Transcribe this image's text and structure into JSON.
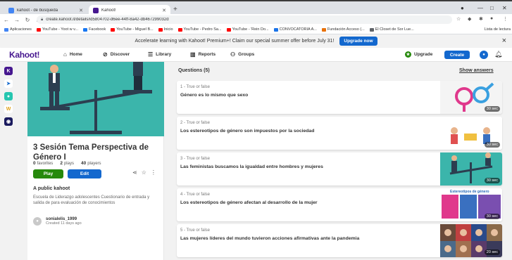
{
  "browser": {
    "tabs": [
      {
        "title": "kahoot - de búsqueda",
        "favicon_color": "#4285f4"
      },
      {
        "title": "Kahoot!",
        "favicon_color": "#46178f"
      }
    ],
    "new_tab": "+",
    "url": "create.kahoot.it/details/id5804702-d6ee-44ff-8a42-db467299032d",
    "bookmarks": [
      {
        "label": "Aplicaciones",
        "color": "#4285f4"
      },
      {
        "label": "YouTube - Yoot w v...",
        "color": "#ff0000"
      },
      {
        "label": "Facebook",
        "color": "#1877f2"
      },
      {
        "label": "YouTube - Miguel B...",
        "color": "#ff0000"
      },
      {
        "label": "Inicio",
        "color": "#ff0000"
      },
      {
        "label": "YouTube - Pedro Sa...",
        "color": "#ff0000"
      },
      {
        "label": "YouTube - 'Rein Do...",
        "color": "#ff0000"
      },
      {
        "label": "CONVOCATORIA A...",
        "color": "#1a73e8"
      },
      {
        "label": "Fundación Acceso (...",
        "color": "#e8710a"
      },
      {
        "label": "El Closet de Sor Lue...",
        "color": "#5f6368"
      }
    ],
    "bookmarks_right": "Lista de lectura"
  },
  "banner": {
    "text": "Accelerate learning with Kahoot! Premium+! Claim our special summer offer before July 31!",
    "button": "Upgrade now",
    "close": "×"
  },
  "nav": {
    "logo": "Kahoot!",
    "items": [
      {
        "label": "Home",
        "icon": "⌂"
      },
      {
        "label": "Discover",
        "icon": "⊘"
      },
      {
        "label": "Library",
        "icon": "☰"
      },
      {
        "label": "Reports",
        "icon": "▥"
      },
      {
        "label": "Groups",
        "icon": "⚇"
      }
    ],
    "upgrade": "Upgrade",
    "create": "Create",
    "avatar_initial": "●"
  },
  "kahoot": {
    "title": "3 Sesión Tema Perspectiva de Género I",
    "favorites_count": "0",
    "favorites_label": "favorites",
    "plays_count": "2",
    "plays_label": "plays",
    "players_count": "40",
    "players_label": "players",
    "play_label": "Play",
    "edit_label": "Edit",
    "visibility": "A public kahoot",
    "description": "Escuela de Liderazgo adolescentes Cuestionario de entrada y salida de para evaluación de conocimientos",
    "owner": "sonialelis_1999",
    "created": "Created 11 days ago"
  },
  "questions_heading": "Questions (5)",
  "show_answers": "Show answers",
  "questions": [
    {
      "type": "1 - True or false",
      "text": "Género es lo mismo que sexo",
      "time": "30 sec"
    },
    {
      "type": "2 - True or false",
      "text": "Los estereotipos de género son impuestos por la sociedad",
      "time": "30 sec",
      "thumb_caption": "Estereotipos de género"
    },
    {
      "type": "3 - True or false",
      "text": "Las feministas buscamos la igualdad entre hombres y mujeres",
      "time": "30 sec"
    },
    {
      "type": "4 - True or false",
      "text": "Los estereotipos de género afectan al desarrollo de la mujer",
      "time": "30 sec",
      "thumb_caption": "Estereotipos de género"
    },
    {
      "type": "5 - True or false",
      "text": "Las mujeres líderes del mundo tuvieron acciones afirmativas ante la pandemia",
      "time": "20 sec"
    }
  ],
  "colors": {
    "kahoot_purple": "#46178f",
    "blue": "#1368ce",
    "green": "#26890c",
    "cover_teal": "#3bb5ab"
  }
}
